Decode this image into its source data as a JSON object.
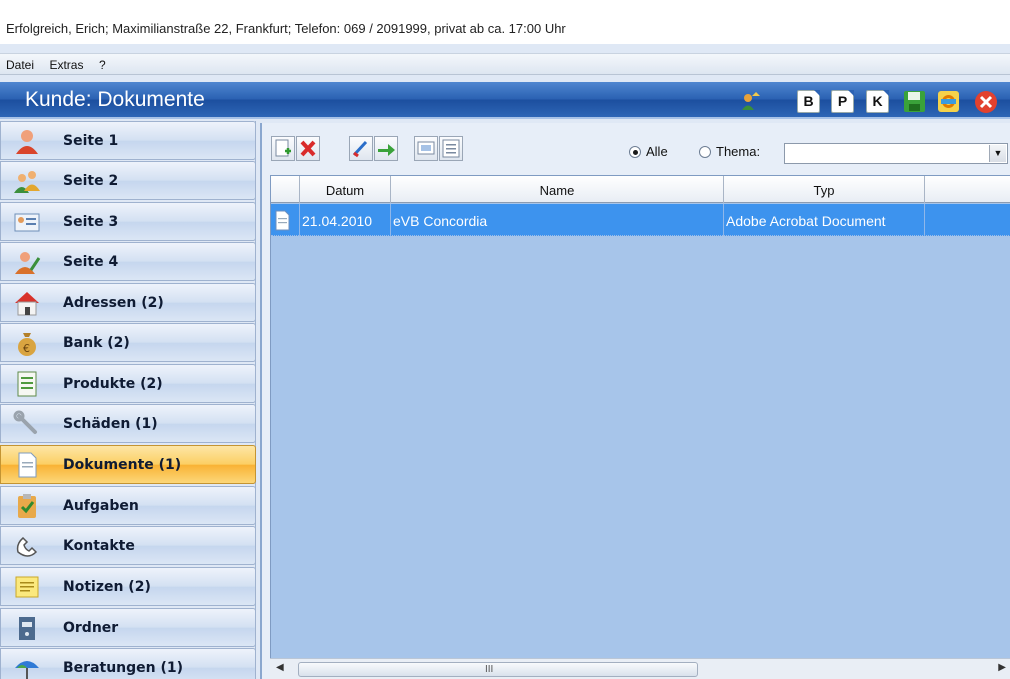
{
  "window_title": "Erfolgreich, Erich; Maximilianstraße 22, Frankfurt; Telefon: 069 / 2091999, privat ab ca. 17:00 Uhr",
  "menu": [
    "Datei",
    "Extras",
    "?"
  ],
  "header": {
    "title": "Kunde: Dokumente",
    "buttons": [
      {
        "name": "assign-icon",
        "label": ""
      },
      {
        "name": "b-icon",
        "label": "B"
      },
      {
        "name": "p-icon",
        "label": "P"
      },
      {
        "name": "k-icon",
        "label": "K"
      },
      {
        "name": "save-icon",
        "label": ""
      },
      {
        "name": "refresh-icon",
        "label": ""
      },
      {
        "name": "close-icon",
        "label": ""
      }
    ]
  },
  "sidebar": {
    "items": [
      {
        "label": "Seite 1",
        "icon": "person-icon",
        "active": false
      },
      {
        "label": "Seite 2",
        "icon": "people-icon",
        "active": false
      },
      {
        "label": "Seite 3",
        "icon": "id-card-icon",
        "active": false
      },
      {
        "label": "Seite 4",
        "icon": "person-edit-icon",
        "active": false
      },
      {
        "label": "Adressen (2)",
        "icon": "house-icon",
        "active": false
      },
      {
        "label": "Bank (2)",
        "icon": "money-bag-icon",
        "active": false
      },
      {
        "label": "Produkte (2)",
        "icon": "list-icon",
        "active": false
      },
      {
        "label": "Schäden (1)",
        "icon": "wrench-icon",
        "active": false
      },
      {
        "label": "Dokumente (1)",
        "icon": "document-icon",
        "active": true
      },
      {
        "label": "Aufgaben",
        "icon": "clipboard-check-icon",
        "active": false
      },
      {
        "label": "Kontakte",
        "icon": "phone-icon",
        "active": false
      },
      {
        "label": "Notizen (2)",
        "icon": "notes-icon",
        "active": false
      },
      {
        "label": "Ordner",
        "icon": "folder-icon",
        "active": false
      },
      {
        "label": "Beratungen (1)",
        "icon": "umbrella-icon",
        "active": false
      }
    ]
  },
  "filter": {
    "option_all": "Alle",
    "option_topic": "Thema:",
    "selected": "Alle",
    "topic_value": ""
  },
  "table": {
    "columns": [
      "",
      "Datum",
      "Name",
      "Typ",
      ""
    ],
    "rows": [
      {
        "date": "21.04.2010",
        "name": "eVB Concordia",
        "type": "Adobe Acrobat Document",
        "selected": true
      }
    ]
  },
  "scrollbar_glyph": "III"
}
